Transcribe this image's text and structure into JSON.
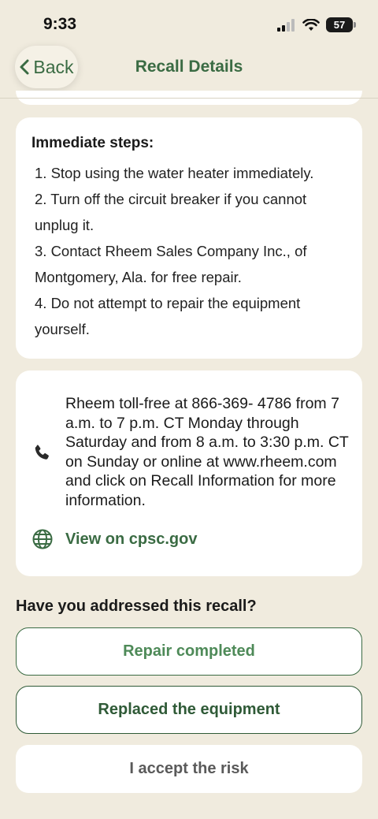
{
  "status_bar": {
    "time": "9:33",
    "battery": "57"
  },
  "nav": {
    "back_label": "Back",
    "title": "Recall Details"
  },
  "steps": {
    "heading": "Immediate steps:",
    "items": [
      "1. Stop using the water heater immediately.",
      "2. Turn off the circuit breaker if you cannot",
      "unplug it.",
      "3. Contact Rheem Sales Company Inc., of",
      "Montgomery, Ala. for free repair.",
      "4. Do not attempt to repair the equipment",
      "yourself."
    ]
  },
  "contact": {
    "phone_icon": "phone-icon",
    "lines": [
      "Rheem toll-free at 866-369- 4786 from 7",
      "a.m. to 7 p.m. CT Monday through",
      "Saturday and from 8 a.m. to 3:30 p.m. CT",
      "on Sunday or online at www.rheem.com",
      "and click on Recall Information for more",
      "information."
    ],
    "link_icon": "globe-icon",
    "link_label": "View on cpsc.gov"
  },
  "resolution": {
    "question": "Have you addressed this recall?",
    "options": {
      "repair": "Repair completed",
      "replace": "Replaced the equipment",
      "risk": "I accept the risk"
    }
  },
  "colors": {
    "background": "#f0ebde",
    "accent_green": "#3a6b43",
    "card": "#ffffff"
  }
}
